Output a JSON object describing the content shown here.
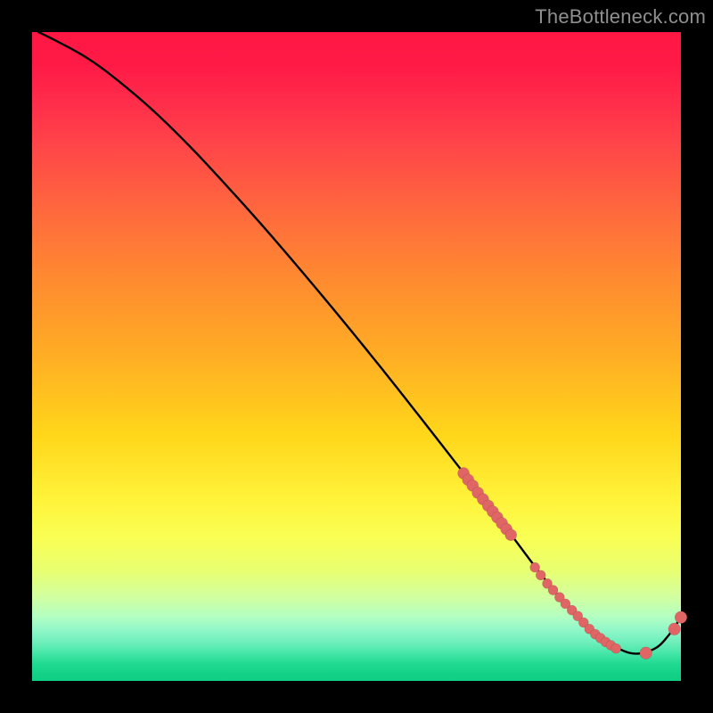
{
  "watermark": "TheBottleneck.com",
  "colors": {
    "dot": "#e06666",
    "curve": "#000000",
    "gradient_top": "#ff1744",
    "gradient_bottom": "#10cf85"
  },
  "chart_data": {
    "type": "line",
    "title": "",
    "xlabel": "",
    "ylabel": "",
    "xlim": [
      0,
      100
    ],
    "ylim": [
      0,
      100
    ],
    "grid": false,
    "legend": false,
    "curve": {
      "name": "bottleneck-curve",
      "x": [
        1,
        4,
        8,
        12,
        18,
        24,
        30,
        36,
        42,
        48,
        54,
        60,
        66,
        70,
        74,
        78,
        82,
        86,
        90,
        93,
        96,
        98,
        100
      ],
      "y": [
        100,
        98.5,
        96.3,
        93.5,
        88.5,
        82.7,
        76.3,
        69.6,
        62.6,
        55.4,
        48.0,
        40.4,
        32.7,
        27.5,
        22.3,
        17.0,
        12.1,
        8.0,
        5.2,
        4.2,
        5.0,
        6.9,
        9.8
      ]
    },
    "highlight_points_start": {
      "name": "curve-sample-dots-upper",
      "x": [
        66.5,
        67.2,
        67.9,
        68.7,
        69.5,
        70.3,
        71.0,
        71.7,
        72.4,
        73.1,
        73.8
      ],
      "y": [
        32.0,
        31.0,
        30.1,
        29.0,
        28.0,
        27.0,
        26.1,
        25.2,
        24.3,
        23.4,
        22.5
      ]
    },
    "highlight_points_bottom": {
      "name": "curve-sample-dots-trough",
      "x": [
        77.5,
        78.4,
        79.4,
        80.3,
        81.3,
        82.2,
        83.2,
        84.1,
        85.0,
        85.9,
        86.8,
        87.6,
        88.4,
        89.2,
        90.0
      ],
      "y": [
        17.5,
        16.3,
        15.0,
        14.0,
        12.9,
        11.9,
        10.9,
        10.0,
        9.0,
        8.0,
        7.2,
        6.6,
        6.0,
        5.5,
        5.0
      ]
    },
    "highlight_points_right": {
      "name": "curve-sample-dots-uptick",
      "x": [
        94.6,
        99.0,
        100.0
      ],
      "y": [
        4.3,
        8.0,
        9.8
      ]
    }
  }
}
